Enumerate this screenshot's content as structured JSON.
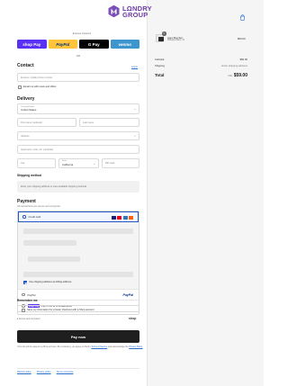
{
  "brand": {
    "line1": "LΩNDRY",
    "line2": "GROUP",
    "color": "#6b3aa6"
  },
  "express": {
    "title": "Express checkout",
    "buttons": [
      {
        "label": "shop Pay",
        "color": "#5a31f4"
      },
      {
        "label": "PayPal",
        "color": "#ffc439"
      },
      {
        "label": "G Pay",
        "color": "#000000"
      },
      {
        "label": "venmo",
        "color": "#3d95ce"
      }
    ],
    "or": "OR"
  },
  "contact": {
    "title": "Contact",
    "login": "Log in",
    "email_placeholder": "Email or mobile phone number",
    "newsletter": "Email me with news and offers"
  },
  "delivery": {
    "title": "Delivery",
    "country_label": "Country/Region",
    "country_value": "United States",
    "first_name": "First name (optional)",
    "last_name": "Last name",
    "address": "Address",
    "apartment": "Apartment, suite, etc. (optional)",
    "city": "City",
    "state_label": "State",
    "state_value": "California",
    "zip": "ZIP code"
  },
  "shipping": {
    "title": "Shipping method",
    "placeholder": "Enter your shipping address to view available shipping methods."
  },
  "payment": {
    "title": "Payment",
    "subtitle": "All transactions are secure and encrypted.",
    "credit_card": "Credit card",
    "card_brands": [
      {
        "name": "visa",
        "color": "#1a1f71"
      },
      {
        "name": "mastercard",
        "color": "#eb001b"
      },
      {
        "name": "amex",
        "color": "#2e77bc"
      },
      {
        "name": "discover",
        "color": "#ff6000"
      }
    ],
    "billing_same": "Use shipping address as billing address",
    "paypal": "PayPal",
    "paypal_brand": "PayPal",
    "shoppay_badge": "shop Pay",
    "shoppay_text": "Pay in full or in installments"
  },
  "remember": {
    "title": "Remember me",
    "option": "Save my information for a faster checkout with a Shop account",
    "secure": "Secure and encrypted",
    "shop": "shop"
  },
  "paynow": "Pay now",
  "terms": {
    "text1": "Your info will be saved to a Shop account. By continuing, you agree to Shop's",
    "terms_link": "Terms of Service",
    "text2": "and acknowledge the",
    "privacy_link": "Privacy Policy."
  },
  "footer": [
    "Refund policy",
    "Privacy policy",
    "Terms of service"
  ],
  "summary": {
    "item": {
      "name": "Apex Bomber",
      "variant": "Midnight Black / M",
      "price": "$59.00",
      "qty": "1"
    },
    "subtotal_label": "Subtotal",
    "subtotal_value": "$59.00",
    "shipping_label": "Shipping",
    "shipping_value": "Enter shipping address",
    "total_label": "Total",
    "total_currency": "USD",
    "total_value": "$59.00"
  }
}
